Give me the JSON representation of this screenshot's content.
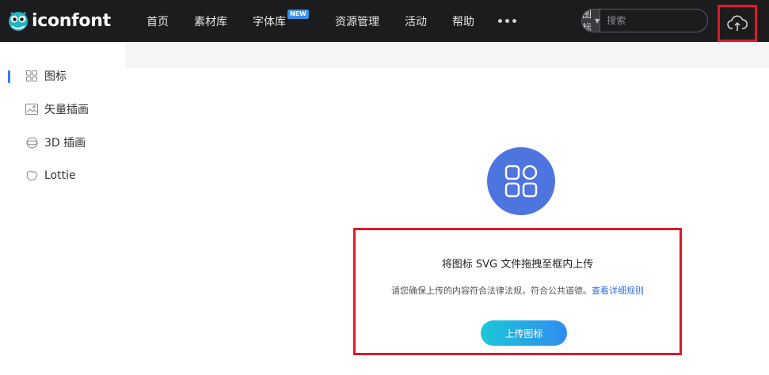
{
  "brand": {
    "name": "iconfont"
  },
  "nav": {
    "items": [
      {
        "label": "首页"
      },
      {
        "label": "素材库"
      },
      {
        "label": "字体库",
        "badge": "NEW"
      },
      {
        "label": "资源管理"
      },
      {
        "label": "活动"
      },
      {
        "label": "帮助"
      }
    ]
  },
  "search": {
    "type_label": "图标",
    "placeholder": "搜索"
  },
  "sidebar": {
    "items": [
      {
        "label": "图标",
        "icon": "grid-icon",
        "active": true
      },
      {
        "label": "矢量插画",
        "icon": "image-icon"
      },
      {
        "label": "3D 插画",
        "icon": "sphere-icon"
      },
      {
        "label": "Lottie",
        "icon": "lottie-icon"
      }
    ]
  },
  "upload": {
    "title": "将图标 SVG 文件拖拽至框内上传",
    "note": "请您确保上传的内容符合法律法规，符合公共道德。",
    "note_link": "查看详细规则",
    "button_label": "上传图标"
  },
  "colors": {
    "topbar": "#1c1c1f",
    "accent": "#4e74e0",
    "highlight_border": "#e0182a",
    "link": "#2d6cdf"
  }
}
